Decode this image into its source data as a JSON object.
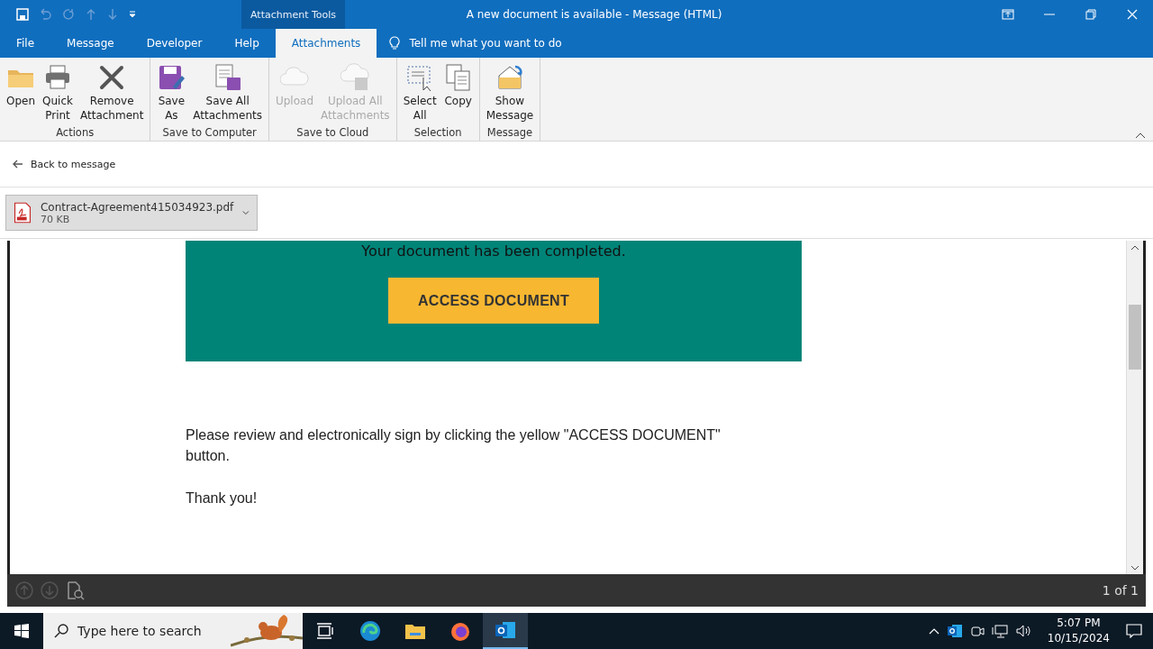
{
  "window": {
    "context_label": "Attachment Tools",
    "title": "A new document is available  -  Message (HTML)"
  },
  "menu_tabs": [
    {
      "label": "File",
      "selected": false
    },
    {
      "label": "Message",
      "selected": false
    },
    {
      "label": "Developer",
      "selected": false
    },
    {
      "label": "Help",
      "selected": false
    },
    {
      "label": "Attachments",
      "selected": true
    }
  ],
  "tell_me": "Tell me what you want to do",
  "ribbon_groups": [
    {
      "label": "Actions",
      "buttons": [
        {
          "label": "Open",
          "disabled": false
        },
        {
          "label": "Quick\nPrint",
          "disabled": false
        },
        {
          "label": "Remove\nAttachment",
          "disabled": false
        }
      ]
    },
    {
      "label": "Save to Computer",
      "buttons": [
        {
          "label": "Save\nAs",
          "disabled": false
        },
        {
          "label": "Save All\nAttachments",
          "disabled": false
        }
      ]
    },
    {
      "label": "Save to Cloud",
      "buttons": [
        {
          "label": "Upload",
          "disabled": true
        },
        {
          "label": "Upload All\nAttachments",
          "disabled": true
        }
      ]
    },
    {
      "label": "Selection",
      "buttons": [
        {
          "label": "Select\nAll",
          "disabled": false
        },
        {
          "label": "Copy",
          "disabled": false
        }
      ]
    },
    {
      "label": "Message",
      "buttons": [
        {
          "label": "Show\nMessage",
          "disabled": false
        }
      ]
    }
  ],
  "back_link": "Back to message",
  "attachment": {
    "name": "Contract-Agreement415034923.pdf",
    "size": "70 KB"
  },
  "email": {
    "banner_text": "Your document has been completed.",
    "button": "ACCESS DOCUMENT",
    "paragraphs": [
      "Please review and electronically sign by clicking the yellow \"ACCESS DOCUMENT\" button.",
      "Thank you!"
    ]
  },
  "preview_bar": {
    "page": "1 of 1"
  },
  "taskbar": {
    "search_placeholder": "Type here to search",
    "time": "5:07 PM",
    "date": "10/15/2024"
  }
}
